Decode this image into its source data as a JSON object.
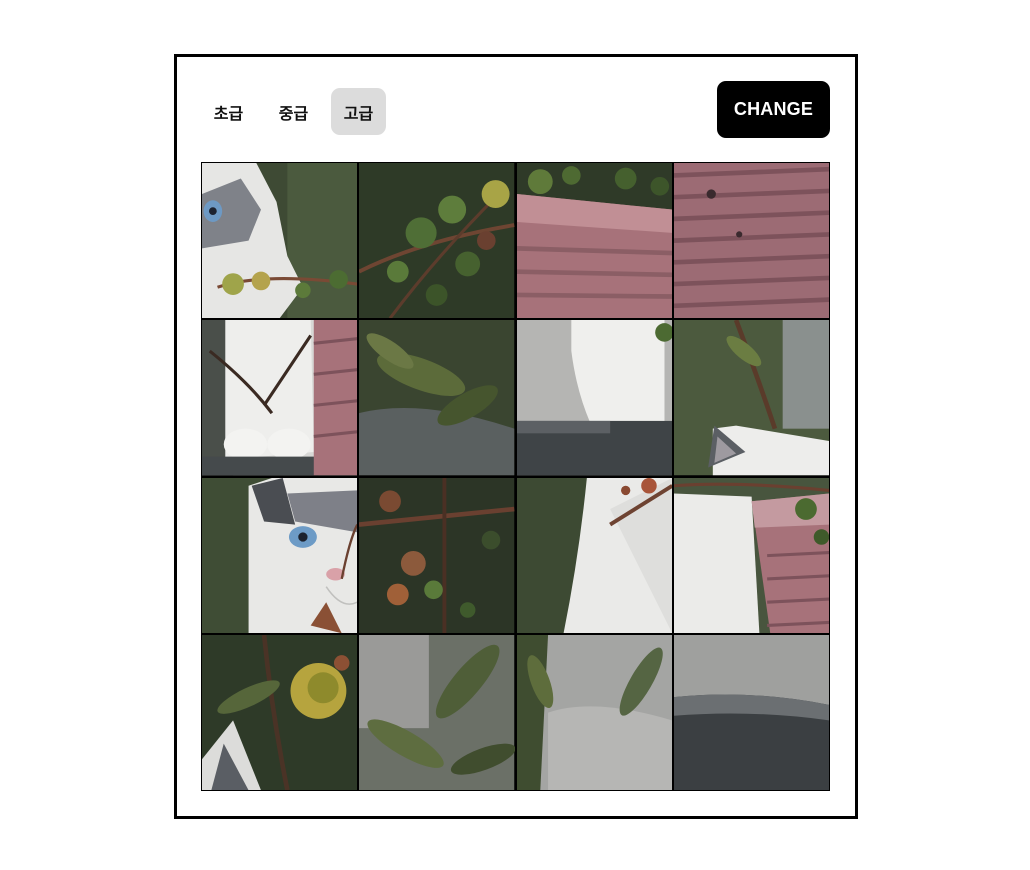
{
  "levels": [
    {
      "label": "초급",
      "active": false
    },
    {
      "label": "중급",
      "active": false
    },
    {
      "label": "고급",
      "active": true
    }
  ],
  "change_button": "CHANGE",
  "puzzle": {
    "grid": "4x4",
    "tiles": [
      {
        "id": 1,
        "content": "cat-face-left-edge"
      },
      {
        "id": 2,
        "content": "green-branch-leaves"
      },
      {
        "id": 3,
        "content": "pink-planter-top-with-leaves"
      },
      {
        "id": 4,
        "content": "pink-planter-ribbed"
      },
      {
        "id": 5,
        "content": "cat-paws-and-planter"
      },
      {
        "id": 6,
        "content": "blurred-green-foliage"
      },
      {
        "id": 7,
        "content": "cat-leg-on-ledge"
      },
      {
        "id": 8,
        "content": "cat-ear-and-branch"
      },
      {
        "id": 9,
        "content": "cat-face-blue-eye"
      },
      {
        "id": 10,
        "content": "dark-branch-orange-leaves"
      },
      {
        "id": 11,
        "content": "cat-body-white"
      },
      {
        "id": 12,
        "content": "cat-back-and-planter"
      },
      {
        "id": 13,
        "content": "yellow-flower-cat-ear"
      },
      {
        "id": 14,
        "content": "blurred-foliage-grey"
      },
      {
        "id": 15,
        "content": "blurred-foliage-light"
      },
      {
        "id": 16,
        "content": "grey-ledge-empty"
      }
    ]
  }
}
